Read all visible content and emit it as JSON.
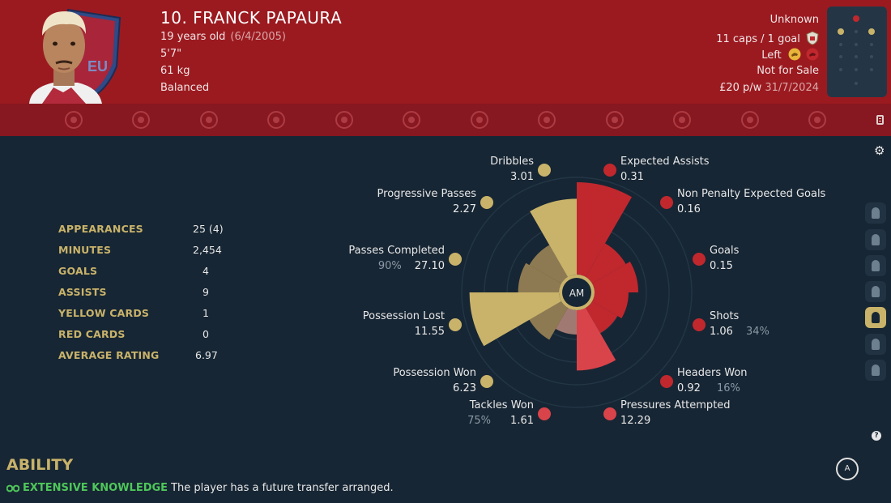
{
  "player": {
    "name": "10. FRANCK PAPAURA",
    "age": "19 years old",
    "dob": "(6/4/2005)",
    "height": "5'7\"",
    "weight": "61 kg",
    "personality": "Balanced",
    "badge_text": "EU"
  },
  "right_info": {
    "status": "Unknown",
    "caps": "11 caps / 1 goal",
    "foot": "Left",
    "transfer": "Not for Sale",
    "wage": "£20 p/w",
    "contract": "31/7/2024"
  },
  "strip_icons": [
    "anchor-icon",
    "ticket-icon",
    "chat-icon",
    "whistle-icon",
    "eye-icon",
    "bandage-icon",
    "helmet-icon",
    "star-badge-icon",
    "kick-icon",
    "wave-icon",
    "target-icon",
    "paw-icon"
  ],
  "stats": [
    {
      "label": "APPEARANCES",
      "value": "25 (4)"
    },
    {
      "label": "MINUTES",
      "value": "2,454"
    },
    {
      "label": "GOALS",
      "value": "4"
    },
    {
      "label": "ASSISTS",
      "value": "9"
    },
    {
      "label": "YELLOW CARDS",
      "value": "1"
    },
    {
      "label": "RED CARDS",
      "value": "0"
    },
    {
      "label": "AVERAGE RATING",
      "value": "6.97"
    }
  ],
  "radar": {
    "center_label": "AM",
    "metrics": [
      {
        "label": "Expected Assists",
        "value": "0.31",
        "pct": "",
        "color": "#c0282e",
        "level": 0.95
      },
      {
        "label": "Non Penalty Expected Goals",
        "value": "0.16",
        "pct": "",
        "color": "#c0282e",
        "level": 0.4
      },
      {
        "label": "Goals",
        "value": "0.15",
        "pct": "",
        "color": "#c0282e",
        "level": 0.45
      },
      {
        "label": "Shots",
        "value": "1.06",
        "pct": "34%",
        "color": "#c0282e",
        "level": 0.35
      },
      {
        "label": "Headers Won",
        "value": "0.92",
        "pct": "16%",
        "color": "#c0282e",
        "level": 0.3
      },
      {
        "label": "Pressures Attempted",
        "value": "12.29",
        "pct": "",
        "color": "#d9434a",
        "level": 0.62
      },
      {
        "label": "Tackles Won",
        "value": "1.61",
        "pct": "75%",
        "color": "#a07a72",
        "level": 0.25
      },
      {
        "label": "Possession Won",
        "value": "6.23",
        "pct": "",
        "color": "#8e7a52",
        "level": 0.38
      },
      {
        "label": "Possession Lost",
        "value": "11.55",
        "pct": "",
        "color": "#c9b36a",
        "level": 0.92
      },
      {
        "label": "Passes Completed",
        "value": "27.10",
        "pct": "90%",
        "color": "#8e7a52",
        "level": 0.42
      },
      {
        "label": "Progressive Passes",
        "value": "2.27",
        "pct": "",
        "color": "#8e7a52",
        "level": 0.38
      },
      {
        "label": "Dribbles",
        "value": "3.01",
        "pct": "",
        "color": "#c9b36a",
        "level": 0.78
      }
    ]
  },
  "ability": {
    "title": "ABILITY",
    "name": "EXTENSIVE KNOWLEDGE",
    "description": "The player has a future transfer arranged."
  },
  "role_badge": "A",
  "help_label": "?",
  "colors": {
    "accent": "#c9b36a",
    "header": "#9b1a20",
    "strip": "#871720",
    "bg": "#172634",
    "good": "#4ec75a"
  }
}
